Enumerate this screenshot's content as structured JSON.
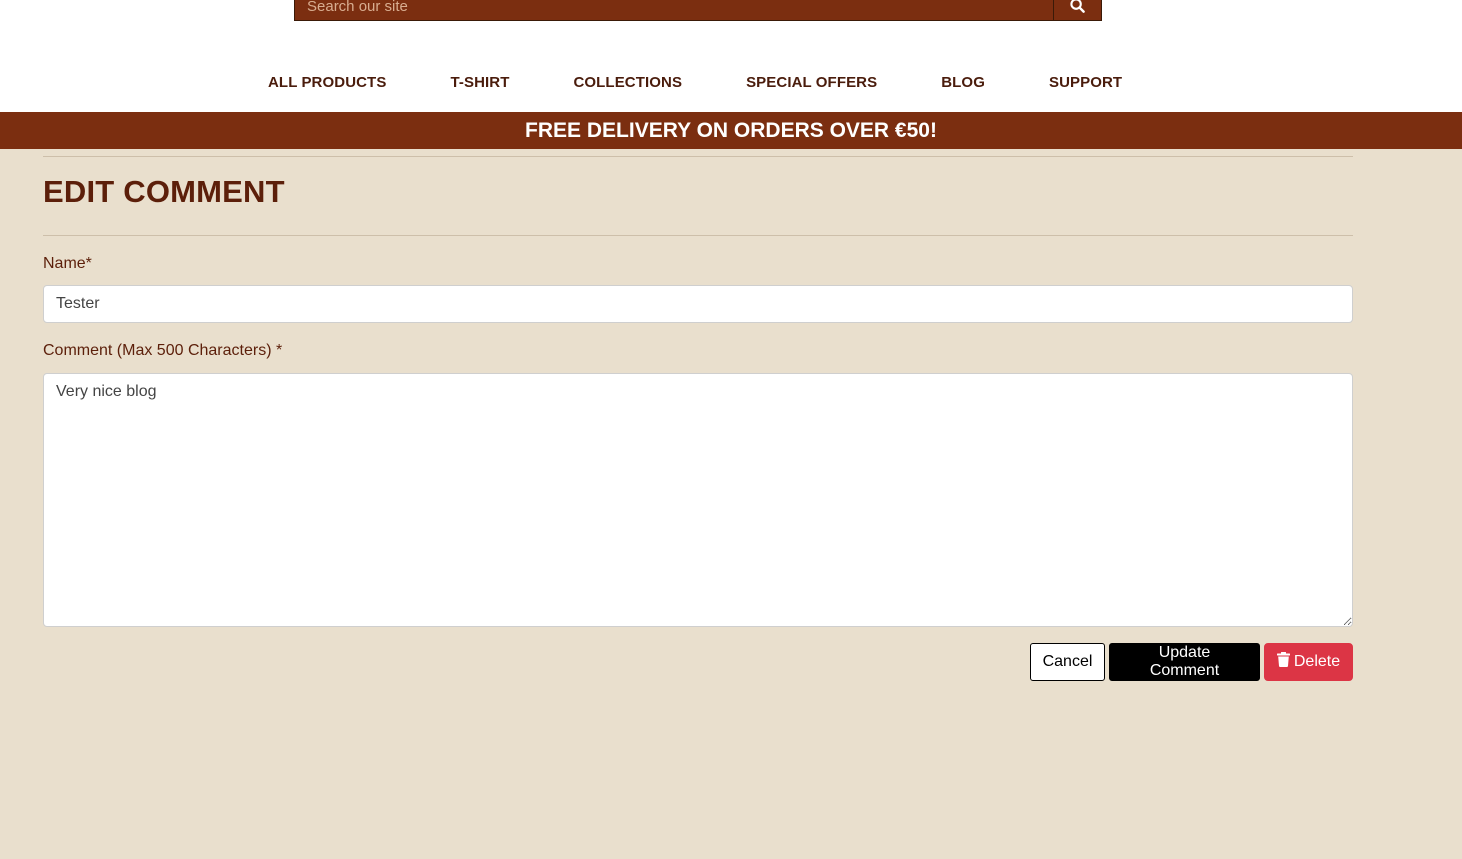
{
  "header": {
    "search": {
      "placeholder": "Search our site",
      "button_icon": "search-icon"
    },
    "nav": [
      {
        "label": "ALL PRODUCTS"
      },
      {
        "label": "T-SHIRT"
      },
      {
        "label": "COLLECTIONS"
      },
      {
        "label": "SPECIAL OFFERS"
      },
      {
        "label": "BLOG"
      },
      {
        "label": "SUPPORT"
      }
    ]
  },
  "banner": {
    "text": "FREE DELIVERY ON ORDERS OVER €50!"
  },
  "form": {
    "title": "EDIT COMMENT",
    "name_label": "Name*",
    "name_value": "Tester",
    "comment_label": "Comment (Max 500 Characters) *",
    "comment_value": "Very nice blog",
    "cancel_label": "Cancel",
    "update_label": "Update Comment",
    "delete_label": "Delete",
    "delete_icon": "trash-icon"
  },
  "colors": {
    "brand": "#7b2e10",
    "page_background": "#e9dfcd",
    "heading": "#5c1f0a",
    "delete": "#dc3545"
  }
}
